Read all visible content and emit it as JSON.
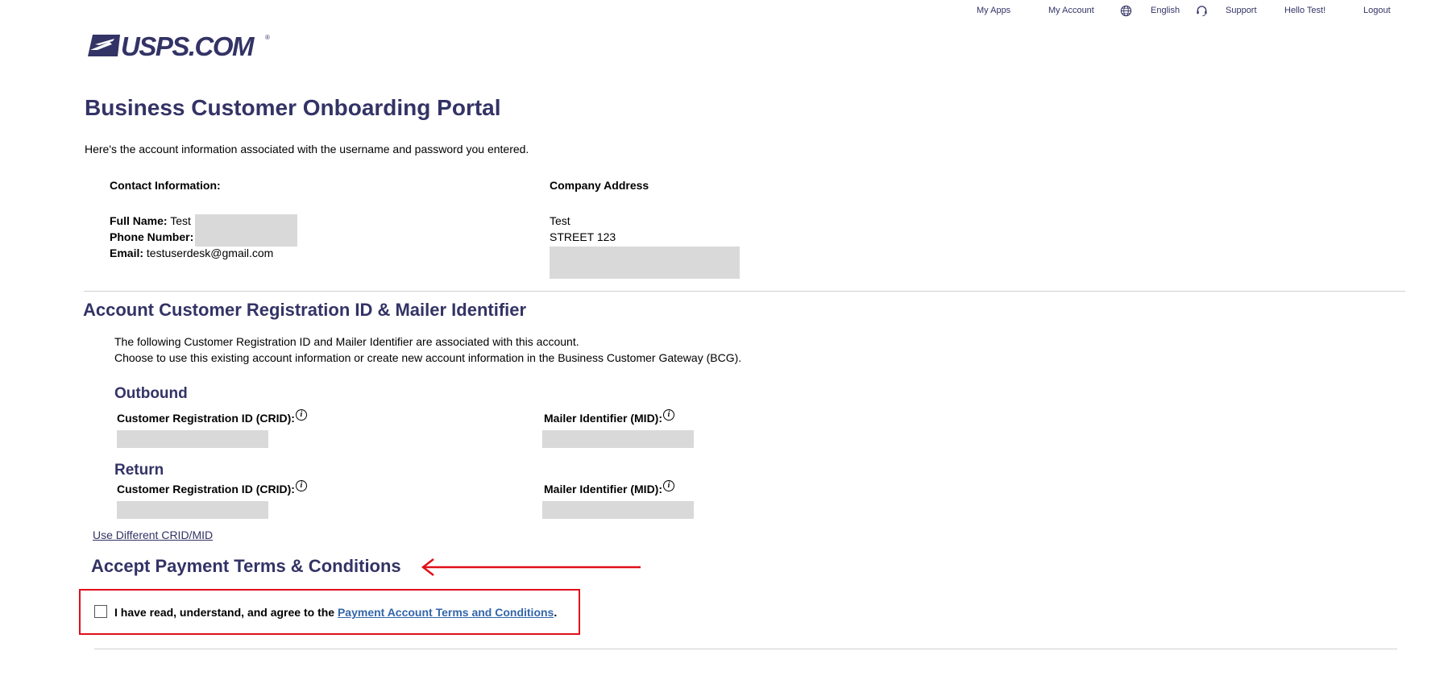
{
  "topnav": {
    "my_apps": "My Apps",
    "my_account": "My Account",
    "language": "English",
    "support": "Support",
    "greeting": "Hello Test!",
    "logout": "Logout"
  },
  "logo": {
    "text": "USPS.COM",
    "reg": "®"
  },
  "page": {
    "title": "Business Customer Onboarding Portal",
    "intro": "Here's the account information associated with the username and password you entered."
  },
  "contact": {
    "heading": "Contact Information:",
    "full_name_label": "Full Name:",
    "full_name_value": "Test",
    "phone_label": "Phone Number:",
    "email_label": "Email:",
    "email_value": "testuserdesk@gmail.com"
  },
  "company": {
    "heading": "Company Address",
    "line1": "Test",
    "line2": "STREET 123"
  },
  "registration": {
    "title": "Account Customer Registration ID & Mailer Identifier",
    "desc1": "The following Customer Registration ID and Mailer Identifier are associated with this account.",
    "desc2": "Choose to use this existing account information or create new account information in the Business Customer Gateway (BCG).",
    "outbound_title": "Outbound",
    "return_title": "Return",
    "crid_label": "Customer Registration ID (CRID):",
    "mid_label": "Mailer Identifier (MID):",
    "info_glyph": "i",
    "use_different_link": "Use Different CRID/MID"
  },
  "payment": {
    "title": "Accept Payment Terms & Conditions",
    "agree_prefix": "I have read, understand, and agree to the ",
    "terms_link": "Payment Account Terms and Conditions",
    "agree_suffix": ".",
    "checkbox_checked": false
  },
  "colors": {
    "brand_navy": "#333366",
    "annotation_red": "#e0101a",
    "link_blue": "#3366aa",
    "redaction_gray": "#d9d9d9"
  }
}
